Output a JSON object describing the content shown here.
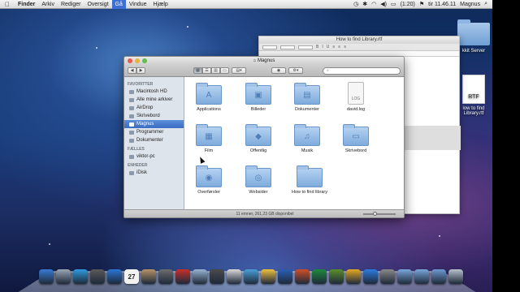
{
  "menubar": {
    "apple_icon": "apple-icon",
    "items": [
      "Finder",
      "Arkiv",
      "Rediger",
      "Oversigt",
      "Gå",
      "Vindue",
      "Hjælp"
    ],
    "active_item": "Gå",
    "battery": "(1:20)",
    "clock": "tir 11.46.11",
    "user": "Magnus"
  },
  "desktop": {
    "icons": [
      {
        "label": "kkit Server",
        "icon": "folder-icon"
      },
      {
        "label": "low to find\nLibrary.rtf",
        "icon": "rtf-document-icon",
        "badge": "RTF"
      }
    ]
  },
  "textedit": {
    "title": "How to find Library.rtf"
  },
  "finder": {
    "title": "Magnus",
    "search_placeholder": "",
    "sidebar": {
      "sections": [
        {
          "header": "FAVORITTER",
          "items": [
            {
              "label": "Macintosh HD",
              "selected": false
            },
            {
              "label": "Alle mine arkiver",
              "selected": false
            },
            {
              "label": "AirDrop",
              "selected": false
            },
            {
              "label": "Skrivebord",
              "selected": false
            },
            {
              "label": "Magnus",
              "selected": true
            },
            {
              "label": "Programmer",
              "selected": false
            },
            {
              "label": "Dokumenter",
              "selected": false
            }
          ]
        },
        {
          "header": "FÆLLES",
          "items": [
            {
              "label": "viktor-pc",
              "selected": false
            }
          ]
        },
        {
          "header": "ENHEDER",
          "items": [
            {
              "label": "iDisk",
              "selected": false
            }
          ]
        }
      ]
    },
    "items": [
      {
        "label": "Applications",
        "glyph": "A"
      },
      {
        "label": "Billeder",
        "glyph": "▣"
      },
      {
        "label": "Dokumenter",
        "glyph": "▤"
      },
      {
        "label": "david.log",
        "glyph": "LOG"
      },
      {
        "label": "Film",
        "glyph": "▦"
      },
      {
        "label": "Offentlig",
        "glyph": "◆"
      },
      {
        "label": "Musik",
        "glyph": "♫"
      },
      {
        "label": "Skrivebord",
        "glyph": "▭"
      },
      {
        "label": "Overførsler",
        "glyph": "◉"
      },
      {
        "label": "Websider",
        "glyph": "◎"
      },
      {
        "label": "How to find library",
        "glyph": ""
      }
    ],
    "status": "11 emner, 261,23 GB disponibel"
  },
  "dock": {
    "items": [
      "finder-icon",
      "launchpad-icon",
      "safari-icon",
      "photo-icon",
      "itunes-icon",
      "calendar-icon",
      "addressbook-icon",
      "preview-icon",
      "photobooth-icon",
      "mail-icon",
      "game-icon",
      "ical-icon",
      "iphoto-icon",
      "app-icon",
      "word-icon",
      "powerpoint-icon",
      "excel-icon",
      "minecraft-icon",
      "chrome-icon",
      "app-store-icon",
      "system-preferences-icon",
      "folder-icon",
      "folder-icon",
      "downloads-icon",
      "trash-icon"
    ],
    "colors": [
      "#3a7bd5",
      "#9aa6b4",
      "#2e9be0",
      "#5a5a5a",
      "#2b75d6",
      "#e9e9e9",
      "#b79266",
      "#6d6d6d",
      "#c8302a",
      "#9ab4d4",
      "#4a4a4a",
      "#d9d9d9",
      "#4aa0d8",
      "#f0c040",
      "#2b5fb5",
      "#d04f28",
      "#1f8a3c",
      "#5c8f2b",
      "#e5a823",
      "#2c7de0",
      "#8a8a8a",
      "#7aa6dc",
      "#7aa6dc",
      "#6e9ad0",
      "#b7c2cc"
    ],
    "calendar_day": "27"
  }
}
